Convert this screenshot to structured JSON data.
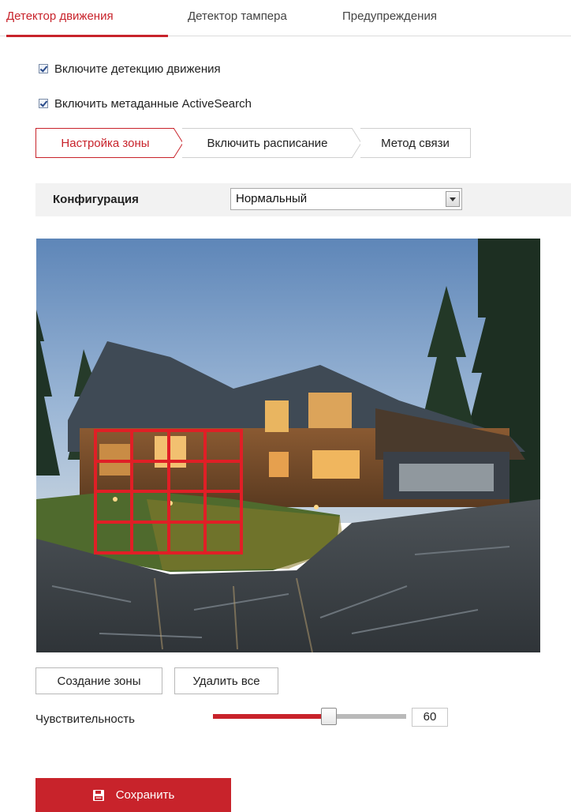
{
  "tabs": [
    {
      "label": "Детектор движения",
      "active": true
    },
    {
      "label": "Детектор тампера",
      "active": false
    },
    {
      "label": "Предупреждения",
      "active": false
    }
  ],
  "checkboxes": [
    {
      "label": "Включите детекцию движения",
      "checked": true
    },
    {
      "label": "Включить метаданные ActiveSearch",
      "checked": true
    }
  ],
  "steps": [
    {
      "label": "Настройка зоны",
      "active": true
    },
    {
      "label": "Включить расписание",
      "active": false
    },
    {
      "label": "Метод связи",
      "active": false
    }
  ],
  "config": {
    "label": "Конфигурация",
    "selected": "Нормальный"
  },
  "zone_buttons": {
    "create": "Создание зоны",
    "delete_all": "Удалить все"
  },
  "sensitivity": {
    "label": "Чувствительность",
    "value": "60",
    "percent": 60
  },
  "save": {
    "label": "Сохранить",
    "icon": "save-icon"
  },
  "colors": {
    "accent": "#c8232b",
    "zone_grid": "#e01f26"
  }
}
